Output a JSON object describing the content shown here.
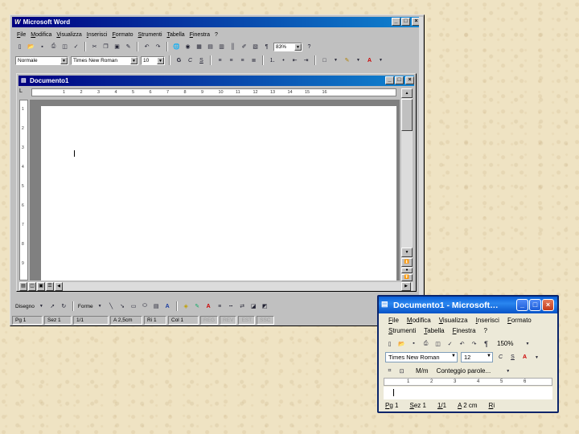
{
  "word": {
    "title": "Microsoft Word",
    "menu": [
      "File",
      "Modifica",
      "Visualizza",
      "Inserisci",
      "Formato",
      "Strumenti",
      "Tabella",
      "Finestra",
      "?"
    ],
    "zoom": "83%",
    "style": "Normale",
    "font": "Times New Roman",
    "size": "10",
    "format_labels": {
      "bold": "G",
      "italic": "C",
      "underline": "S"
    },
    "doc_title": "Documento1",
    "drawing_label": "Disegno",
    "shapes_label": "Forme",
    "status": {
      "page": "Pg 1",
      "section": "Sez 1",
      "pages": "1/1",
      "at": "A 2,5cm",
      "line": "Ri 1",
      "col": "Col 1",
      "rec": "REG",
      "rev": "REV",
      "ext": "EST",
      "ovr": "SSC"
    },
    "ruler_numbers": [
      "1",
      "2",
      "3",
      "4",
      "5",
      "6",
      "7",
      "8",
      "9",
      "10",
      "11",
      "12",
      "13",
      "14",
      "15",
      "16"
    ]
  },
  "xp": {
    "title": "Documento1 - Microsoft…",
    "menu_row1": [
      "File",
      "Modifica",
      "Visualizza",
      "Inserisci",
      "Formato"
    ],
    "menu_row2": [
      "Strumenti",
      "Tabella",
      "Finestra",
      "?"
    ],
    "zoom": "150%",
    "font": "Times New Roman",
    "size": "12",
    "pm": "M/m",
    "wordcount": "Conteggio parole...",
    "status": {
      "page": "Pg 1",
      "section": "Sez 1",
      "pages": "1/1",
      "at": "A 2 cm",
      "line": "Ri"
    },
    "ruler_numbers": [
      "1",
      "2",
      "3",
      "4",
      "5",
      "6"
    ]
  }
}
